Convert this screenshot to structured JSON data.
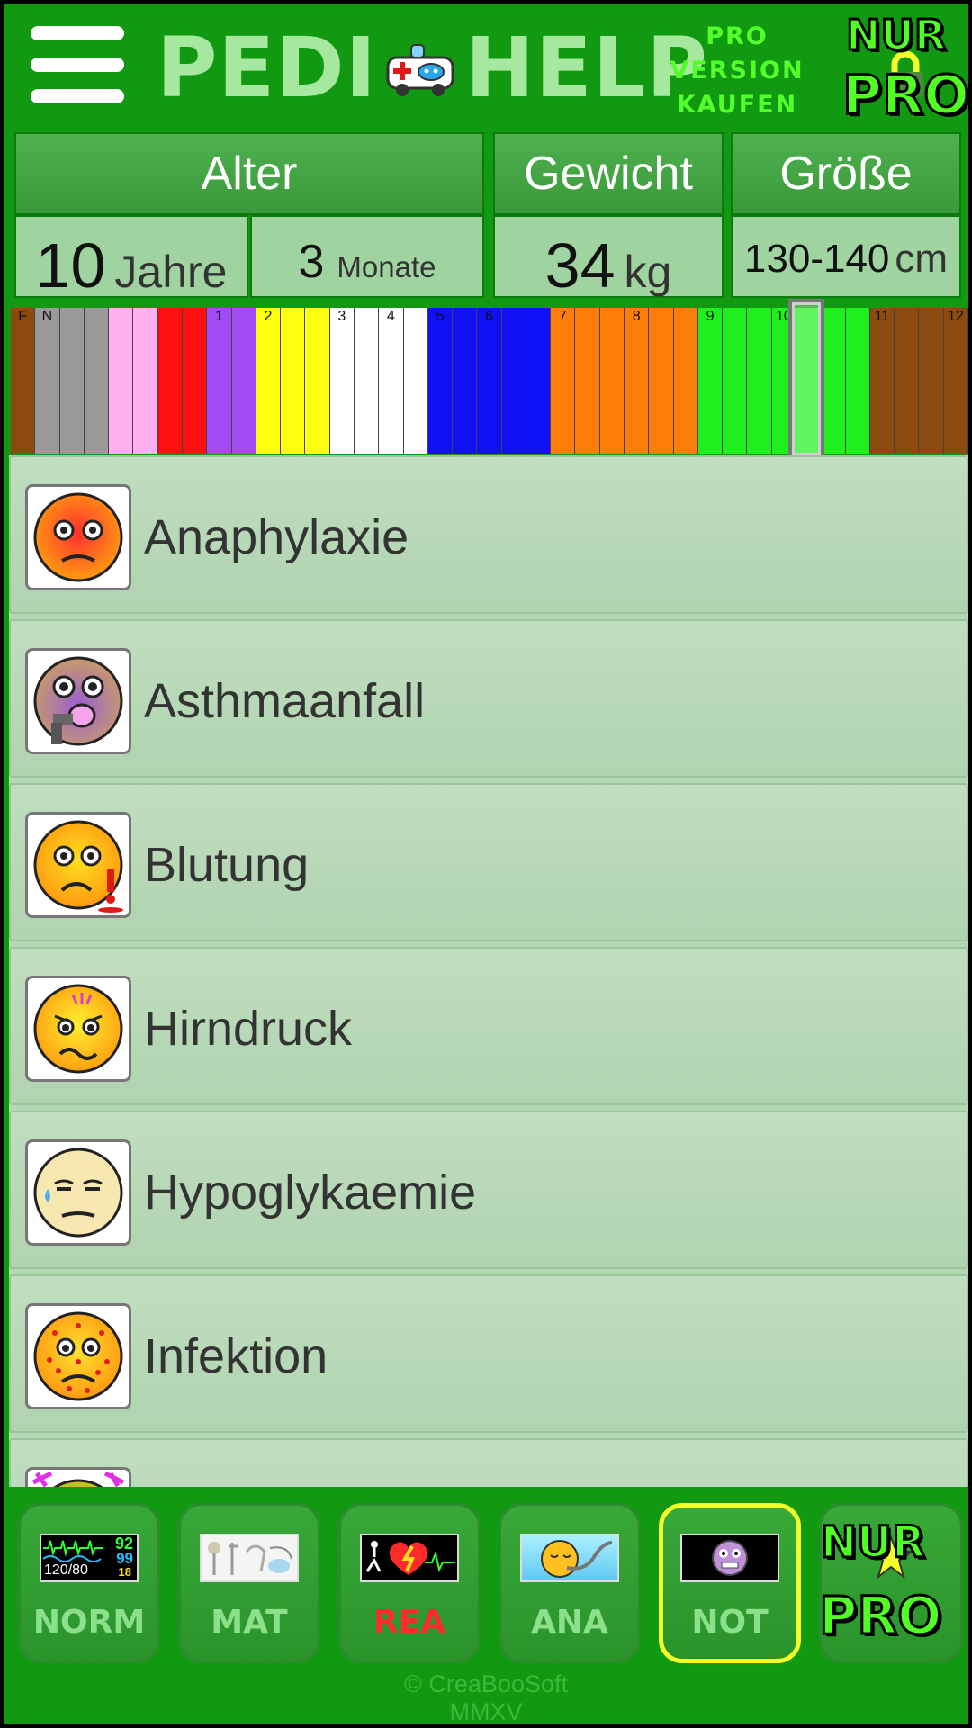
{
  "header": {
    "logo_left": "PEDI",
    "logo_right": "HELP",
    "pro_line1": "PRO",
    "pro_line2": "VERSION",
    "pro_line3": "KAUFEN",
    "nur": "NUR",
    "pro": "PRO"
  },
  "params": {
    "age_label": "Alter",
    "age_years": "10",
    "age_years_unit": "Jahre",
    "age_months": "3",
    "age_months_unit": "Monate",
    "weight_label": "Gewicht",
    "weight_value": "34",
    "weight_unit": "kg",
    "height_label": "Größe",
    "height_value": "130-140",
    "height_unit": "cm"
  },
  "tape": {
    "selected_label": "10",
    "stripes": [
      {
        "color": "#8a4a10",
        "label": "F"
      },
      {
        "color": "#9a9a9a",
        "label": "N"
      },
      {
        "color": "#9a9a9a",
        "label": ""
      },
      {
        "color": "#9a9a9a",
        "label": ""
      },
      {
        "color": "#ffb0ee",
        "label": ""
      },
      {
        "color": "#ffb0ee",
        "label": ""
      },
      {
        "color": "#ff1010",
        "label": ""
      },
      {
        "color": "#ff1010",
        "label": ""
      },
      {
        "color": "#a24af4",
        "label": "1"
      },
      {
        "color": "#a24af4",
        "label": ""
      },
      {
        "color": "#ffff10",
        "label": "2"
      },
      {
        "color": "#ffff10",
        "label": ""
      },
      {
        "color": "#ffff10",
        "label": ""
      },
      {
        "color": "#ffffff",
        "label": "3"
      },
      {
        "color": "#ffffff",
        "label": ""
      },
      {
        "color": "#ffffff",
        "label": "4"
      },
      {
        "color": "#ffffff",
        "label": ""
      },
      {
        "color": "#1010f4",
        "label": "5"
      },
      {
        "color": "#1010f4",
        "label": ""
      },
      {
        "color": "#1010f4",
        "label": "6"
      },
      {
        "color": "#1010f4",
        "label": ""
      },
      {
        "color": "#1010f4",
        "label": ""
      },
      {
        "color": "#ff7d0a",
        "label": "7"
      },
      {
        "color": "#ff7d0a",
        "label": ""
      },
      {
        "color": "#ff7d0a",
        "label": ""
      },
      {
        "color": "#ff7d0a",
        "label": "8"
      },
      {
        "color": "#ff7d0a",
        "label": ""
      },
      {
        "color": "#ff7d0a",
        "label": ""
      },
      {
        "color": "#1ef01e",
        "label": "9"
      },
      {
        "color": "#1ef01e",
        "label": ""
      },
      {
        "color": "#1ef01e",
        "label": ""
      },
      {
        "color": "#1ef01e",
        "label": "10"
      },
      {
        "color": "#1ef01e",
        "label": ""
      },
      {
        "color": "#1ef01e",
        "label": ""
      },
      {
        "color": "#1ef01e",
        "label": ""
      },
      {
        "color": "#8a4a10",
        "label": "11"
      },
      {
        "color": "#8a4a10",
        "label": ""
      },
      {
        "color": "#8a4a10",
        "label": ""
      },
      {
        "color": "#8a4a10",
        "label": "12"
      }
    ]
  },
  "emergencies": [
    {
      "label": "Anaphylaxie",
      "icon": "flushed-face-icon"
    },
    {
      "label": "Asthmaanfall",
      "icon": "asthma-inhaler-face-icon"
    },
    {
      "label": "Blutung",
      "icon": "bleeding-face-icon"
    },
    {
      "label": "Hirndruck",
      "icon": "headache-face-icon"
    },
    {
      "label": "Hypoglykaemie",
      "icon": "sweating-face-icon"
    },
    {
      "label": "Infektion",
      "icon": "rash-face-icon"
    }
  ],
  "nav": {
    "norm": "NORM",
    "norm_monitor": [
      "92",
      "99",
      "120/80",
      "18"
    ],
    "mat": "MAT",
    "rea": "REA",
    "ana": "ANA",
    "not": "NOT",
    "nur": "NUR",
    "pro": "PRO"
  },
  "footer": {
    "line1": "© CreaBooSoft",
    "line2": "MMXV"
  },
  "colors": {
    "background": "#119a11",
    "list_bg": "#b2d8b2",
    "active_nav": "#f4ff2a",
    "pro_green": "#53ff2a"
  }
}
